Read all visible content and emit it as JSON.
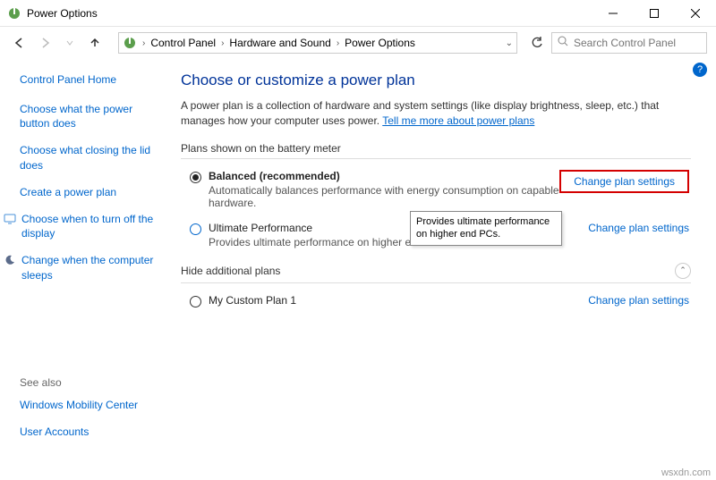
{
  "window": {
    "title": "Power Options"
  },
  "breadcrumb": {
    "items": [
      "Control Panel",
      "Hardware and Sound",
      "Power Options"
    ]
  },
  "search": {
    "placeholder": "Search Control Panel"
  },
  "sidebar": {
    "home": "Control Panel Home",
    "links": [
      "Choose what the power button does",
      "Choose what closing the lid does",
      "Create a power plan",
      "Choose when to turn off the display",
      "Change when the computer sleeps"
    ],
    "see_also_label": "See also",
    "see_also": [
      "Windows Mobility Center",
      "User Accounts"
    ]
  },
  "main": {
    "heading": "Choose or customize a power plan",
    "description_pre": "A power plan is a collection of hardware and system settings (like display brightness, sleep, etc.) that manages how your computer uses power. ",
    "description_link": "Tell me more about power plans",
    "plans_header": "Plans shown on the battery meter",
    "hide_header": "Hide additional plans",
    "change_label": "Change plan settings",
    "plans": [
      {
        "name": "Balanced (recommended)",
        "desc": "Automatically balances performance with energy consumption on capable hardware.",
        "selected": true,
        "highlighted": true
      },
      {
        "name": "Ultimate Performance",
        "desc": "Provides ultimate performance on higher en",
        "selected": false
      }
    ],
    "additional_plans": [
      {
        "name": "My Custom Plan 1",
        "selected": false
      }
    ],
    "tooltip": "Provides ultimate performance on higher end PCs."
  },
  "watermark": "wsxdn.com"
}
